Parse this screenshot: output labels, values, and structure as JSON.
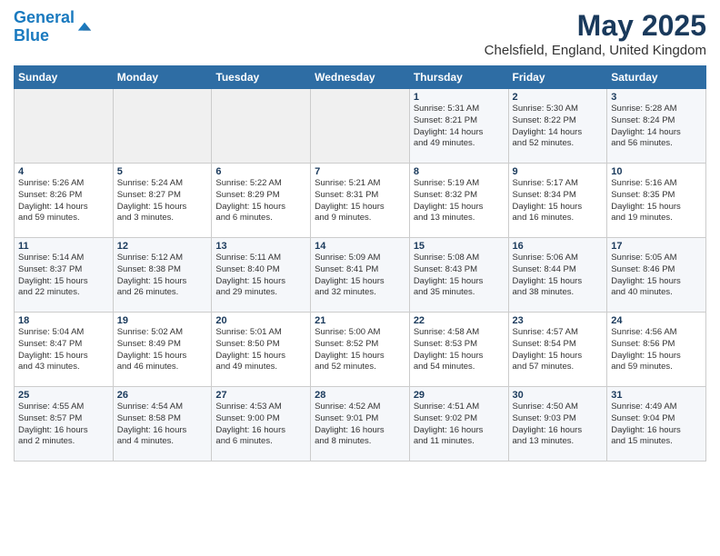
{
  "header": {
    "logo_line1": "General",
    "logo_line2": "Blue",
    "title": "May 2025",
    "subtitle": "Chelsfield, England, United Kingdom"
  },
  "weekdays": [
    "Sunday",
    "Monday",
    "Tuesday",
    "Wednesday",
    "Thursday",
    "Friday",
    "Saturday"
  ],
  "weeks": [
    [
      {
        "day": "",
        "info": ""
      },
      {
        "day": "",
        "info": ""
      },
      {
        "day": "",
        "info": ""
      },
      {
        "day": "",
        "info": ""
      },
      {
        "day": "1",
        "info": "Sunrise: 5:31 AM\nSunset: 8:21 PM\nDaylight: 14 hours\nand 49 minutes."
      },
      {
        "day": "2",
        "info": "Sunrise: 5:30 AM\nSunset: 8:22 PM\nDaylight: 14 hours\nand 52 minutes."
      },
      {
        "day": "3",
        "info": "Sunrise: 5:28 AM\nSunset: 8:24 PM\nDaylight: 14 hours\nand 56 minutes."
      }
    ],
    [
      {
        "day": "4",
        "info": "Sunrise: 5:26 AM\nSunset: 8:26 PM\nDaylight: 14 hours\nand 59 minutes."
      },
      {
        "day": "5",
        "info": "Sunrise: 5:24 AM\nSunset: 8:27 PM\nDaylight: 15 hours\nand 3 minutes."
      },
      {
        "day": "6",
        "info": "Sunrise: 5:22 AM\nSunset: 8:29 PM\nDaylight: 15 hours\nand 6 minutes."
      },
      {
        "day": "7",
        "info": "Sunrise: 5:21 AM\nSunset: 8:31 PM\nDaylight: 15 hours\nand 9 minutes."
      },
      {
        "day": "8",
        "info": "Sunrise: 5:19 AM\nSunset: 8:32 PM\nDaylight: 15 hours\nand 13 minutes."
      },
      {
        "day": "9",
        "info": "Sunrise: 5:17 AM\nSunset: 8:34 PM\nDaylight: 15 hours\nand 16 minutes."
      },
      {
        "day": "10",
        "info": "Sunrise: 5:16 AM\nSunset: 8:35 PM\nDaylight: 15 hours\nand 19 minutes."
      }
    ],
    [
      {
        "day": "11",
        "info": "Sunrise: 5:14 AM\nSunset: 8:37 PM\nDaylight: 15 hours\nand 22 minutes."
      },
      {
        "day": "12",
        "info": "Sunrise: 5:12 AM\nSunset: 8:38 PM\nDaylight: 15 hours\nand 26 minutes."
      },
      {
        "day": "13",
        "info": "Sunrise: 5:11 AM\nSunset: 8:40 PM\nDaylight: 15 hours\nand 29 minutes."
      },
      {
        "day": "14",
        "info": "Sunrise: 5:09 AM\nSunset: 8:41 PM\nDaylight: 15 hours\nand 32 minutes."
      },
      {
        "day": "15",
        "info": "Sunrise: 5:08 AM\nSunset: 8:43 PM\nDaylight: 15 hours\nand 35 minutes."
      },
      {
        "day": "16",
        "info": "Sunrise: 5:06 AM\nSunset: 8:44 PM\nDaylight: 15 hours\nand 38 minutes."
      },
      {
        "day": "17",
        "info": "Sunrise: 5:05 AM\nSunset: 8:46 PM\nDaylight: 15 hours\nand 40 minutes."
      }
    ],
    [
      {
        "day": "18",
        "info": "Sunrise: 5:04 AM\nSunset: 8:47 PM\nDaylight: 15 hours\nand 43 minutes."
      },
      {
        "day": "19",
        "info": "Sunrise: 5:02 AM\nSunset: 8:49 PM\nDaylight: 15 hours\nand 46 minutes."
      },
      {
        "day": "20",
        "info": "Sunrise: 5:01 AM\nSunset: 8:50 PM\nDaylight: 15 hours\nand 49 minutes."
      },
      {
        "day": "21",
        "info": "Sunrise: 5:00 AM\nSunset: 8:52 PM\nDaylight: 15 hours\nand 52 minutes."
      },
      {
        "day": "22",
        "info": "Sunrise: 4:58 AM\nSunset: 8:53 PM\nDaylight: 15 hours\nand 54 minutes."
      },
      {
        "day": "23",
        "info": "Sunrise: 4:57 AM\nSunset: 8:54 PM\nDaylight: 15 hours\nand 57 minutes."
      },
      {
        "day": "24",
        "info": "Sunrise: 4:56 AM\nSunset: 8:56 PM\nDaylight: 15 hours\nand 59 minutes."
      }
    ],
    [
      {
        "day": "25",
        "info": "Sunrise: 4:55 AM\nSunset: 8:57 PM\nDaylight: 16 hours\nand 2 minutes."
      },
      {
        "day": "26",
        "info": "Sunrise: 4:54 AM\nSunset: 8:58 PM\nDaylight: 16 hours\nand 4 minutes."
      },
      {
        "day": "27",
        "info": "Sunrise: 4:53 AM\nSunset: 9:00 PM\nDaylight: 16 hours\nand 6 minutes."
      },
      {
        "day": "28",
        "info": "Sunrise: 4:52 AM\nSunset: 9:01 PM\nDaylight: 16 hours\nand 8 minutes."
      },
      {
        "day": "29",
        "info": "Sunrise: 4:51 AM\nSunset: 9:02 PM\nDaylight: 16 hours\nand 11 minutes."
      },
      {
        "day": "30",
        "info": "Sunrise: 4:50 AM\nSunset: 9:03 PM\nDaylight: 16 hours\nand 13 minutes."
      },
      {
        "day": "31",
        "info": "Sunrise: 4:49 AM\nSunset: 9:04 PM\nDaylight: 16 hours\nand 15 minutes."
      }
    ]
  ]
}
